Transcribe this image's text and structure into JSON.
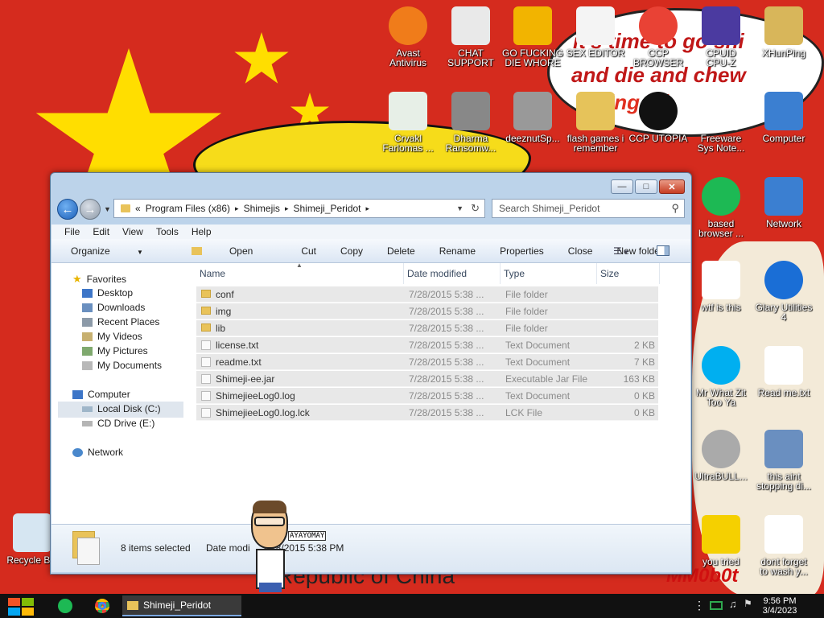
{
  "desktop": {
    "banner_line1": "it's time to go shi",
    "banner_line2": "and die and chew",
    "banner_line3": "ing illi",
    "bottom_text": "Republic of China",
    "watermark": "MM0b0t",
    "sticker_text": "AYAYOMAY",
    "icons": [
      {
        "label": "Avast\nAntivirus",
        "icon": "avast-icon",
        "color": "#f07c1a"
      },
      {
        "label": "CHAT\nSUPPORT",
        "icon": "doctor-icon",
        "color": "#e9e9e9"
      },
      {
        "label": "GO FUCKING\nDIE WHORE",
        "icon": "de-icon",
        "color": "#f2b400"
      },
      {
        "label": "SEX EDITOR",
        "icon": "hxd-icon",
        "color": "#f4f4f4"
      },
      {
        "label": "CCP\nBROWSER",
        "icon": "chrome-icon",
        "color": "#e94235"
      },
      {
        "label": "CPUID\nCPU-Z",
        "icon": "cpuz-icon",
        "color": "#4b3aa0"
      },
      {
        "label": "XHunPing",
        "icon": "user-folder-icon",
        "color": "#d8b65a"
      },
      {
        "label": "Crvakl\nFarlomas ...",
        "icon": "window-app-icon",
        "color": "#e7efe7"
      },
      {
        "label": "Dharma\nRansomw...",
        "icon": "skull-icon",
        "color": "#888"
      },
      {
        "label": "deeznutSp...",
        "icon": "stacked-windows-icon",
        "color": "#999"
      },
      {
        "label": "flash games i\nremember",
        "icon": "folder-icon",
        "color": "#e6c35a"
      },
      {
        "label": "CCP UTOPIA",
        "icon": "dark-circle-icon",
        "color": "#111"
      },
      {
        "label": "Freeware\nSys Note...",
        "icon": "blank-doc-icon",
        "color": "#fff"
      },
      {
        "label": "Computer",
        "icon": "computer-icon",
        "color": "#3b7fd1"
      },
      {
        "label": "based\nbrowser ...",
        "icon": "green-chat-icon",
        "color": "#1db954"
      },
      {
        "label": "Network",
        "icon": "network-icon",
        "color": "#3b7fd1"
      },
      {
        "label": "wtf is this",
        "icon": "doc-grid-icon",
        "color": "#fff"
      },
      {
        "label": "Glary Utilities\n4",
        "icon": "glary-icon",
        "color": "#1a6ed6"
      },
      {
        "label": "Mr What Zit\nToo Ya",
        "icon": "skype-icon",
        "color": "#00aff0"
      },
      {
        "label": "Read me.txt",
        "icon": "text-file-icon",
        "color": "#fff"
      },
      {
        "label": "UltraBULL...",
        "icon": "disc-icon",
        "color": "#aaa"
      },
      {
        "label": "this aint\nstopping di...",
        "icon": "installer-icon",
        "color": "#6a8fc0"
      },
      {
        "label": "you tried",
        "icon": "star-icon",
        "color": "#f5d000"
      },
      {
        "label": "dont forget\nto wash y...",
        "icon": "doc-grid-icon",
        "color": "#fff"
      },
      {
        "label": "Recycle Bin",
        "icon": "recycle-bin-icon",
        "color": "#d6e6f2"
      }
    ]
  },
  "window": {
    "title_buttons": [
      "minimize",
      "maximize",
      "close"
    ],
    "breadcrumb": [
      "Program Files (x86)",
      "Shimejis",
      "Shimeji_Peridot"
    ],
    "breadcrumb_prefix": "«",
    "search_placeholder": "Search Shimeji_Peridot",
    "menu": [
      "File",
      "Edit",
      "View",
      "Tools",
      "Help"
    ],
    "commands": [
      "Organize",
      "Open",
      "Cut",
      "Copy",
      "Delete",
      "Rename",
      "Properties",
      "Close",
      "New folder"
    ],
    "nav": {
      "favorites": "Favorites",
      "favorites_items": [
        "Desktop",
        "Downloads",
        "Recent Places",
        "My Videos",
        "My Pictures",
        "My Documents"
      ],
      "computer": "Computer",
      "computer_items": [
        "Local Disk (C:)",
        "CD Drive (E:)"
      ],
      "network": "Network"
    },
    "columns": [
      "Name",
      "Date modified",
      "Type",
      "Size"
    ],
    "files": [
      {
        "name": "conf",
        "date": "7/28/2015 5:38 ...",
        "type": "File folder",
        "size": ""
      },
      {
        "name": "img",
        "date": "7/28/2015 5:38 ...",
        "type": "File folder",
        "size": ""
      },
      {
        "name": "lib",
        "date": "7/28/2015 5:38 ...",
        "type": "File folder",
        "size": ""
      },
      {
        "name": "license.txt",
        "date": "7/28/2015 5:38 ...",
        "type": "Text Document",
        "size": "2 KB"
      },
      {
        "name": "readme.txt",
        "date": "7/28/2015 5:38 ...",
        "type": "Text Document",
        "size": "7 KB"
      },
      {
        "name": "Shimeji-ee.jar",
        "date": "7/28/2015 5:38 ...",
        "type": "Executable Jar File",
        "size": "163 KB"
      },
      {
        "name": "ShimejieeLog0.log",
        "date": "7/28/2015 5:38 ...",
        "type": "Text Document",
        "size": "0 KB"
      },
      {
        "name": "ShimejieeLog0.log.lck",
        "date": "7/28/2015 5:38 ...",
        "type": "LCK File",
        "size": "0 KB"
      }
    ],
    "details_selected": "8 items selected",
    "details_date_label": "Date modi",
    "details_date_value": "7/28/2015 5:38 PM"
  },
  "taskbar": {
    "task_label": "Shimeji_Peridot",
    "time": "9:56 PM",
    "date": "3/4/2023"
  }
}
